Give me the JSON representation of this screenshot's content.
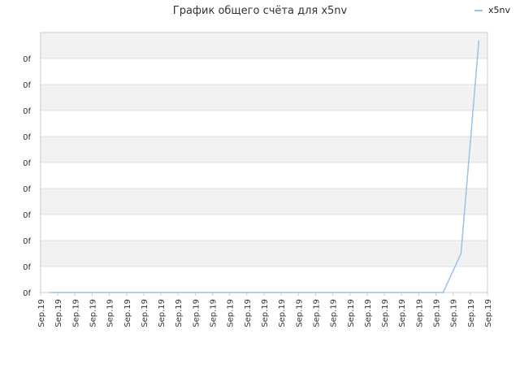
{
  "chart_data": {
    "type": "line",
    "title": "График общего счёта для x5nv",
    "legend": {
      "position": "top-right"
    },
    "series": [
      {
        "name": "x5nv",
        "color": "#99c2e8",
        "values": [
          0,
          0,
          0,
          0,
          0,
          0,
          0,
          0,
          0,
          0,
          0,
          0,
          0,
          0,
          0,
          0,
          0,
          0,
          0,
          0,
          0,
          0,
          0,
          0.15,
          0.97
        ]
      }
    ],
    "categories": [
      "Sep.19",
      "Sep.19",
      "Sep.19",
      "Sep.19",
      "Sep.19",
      "Sep.19",
      "Sep.19",
      "Sep.19",
      "Sep.19",
      "Sep.19",
      "Sep.19",
      "Sep.19",
      "Sep.19",
      "Sep.19",
      "Sep.19",
      "Sep.19",
      "Sep.19",
      "Sep.19",
      "Sep.19",
      "Sep.19",
      "Sep.19",
      "Sep.19",
      "Sep.19",
      "Sep.19",
      "Sep.19",
      "Sep.19",
      "Sep.19"
    ],
    "y_tick_labels": [
      "0f",
      "0f",
      "0f",
      "0f",
      "0f",
      "0f",
      "0f",
      "0f",
      "0f",
      "0f"
    ],
    "ylim": [
      0,
      1
    ],
    "grid": true,
    "band_colors": [
      "#f2f2f2",
      "#ffffff"
    ],
    "grid_color": "#e0e0e0",
    "axis_color": "#cccccc"
  }
}
